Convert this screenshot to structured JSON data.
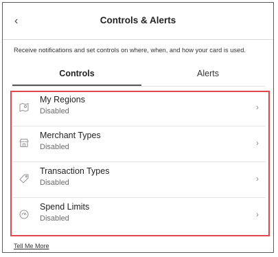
{
  "header": {
    "back_glyph": "‹",
    "title": "Controls & Alerts"
  },
  "description": "Receive notifications and set controls on where, when, and how your card is used.",
  "tabs": [
    {
      "label": "Controls",
      "active": true
    },
    {
      "label": "Alerts",
      "active": false
    }
  ],
  "controls": [
    {
      "title": "My Regions",
      "status": "Disabled",
      "icon": "map-pin-icon"
    },
    {
      "title": "Merchant Types",
      "status": "Disabled",
      "icon": "storefront-icon"
    },
    {
      "title": "Transaction Types",
      "status": "Disabled",
      "icon": "tag-icon"
    },
    {
      "title": "Spend Limits",
      "status": "Disabled",
      "icon": "gauge-icon"
    }
  ],
  "chevron_glyph": "›",
  "footer_link": "Tell Me More",
  "colors": {
    "highlight": "#e0474c",
    "tab_underline": "#555555"
  }
}
